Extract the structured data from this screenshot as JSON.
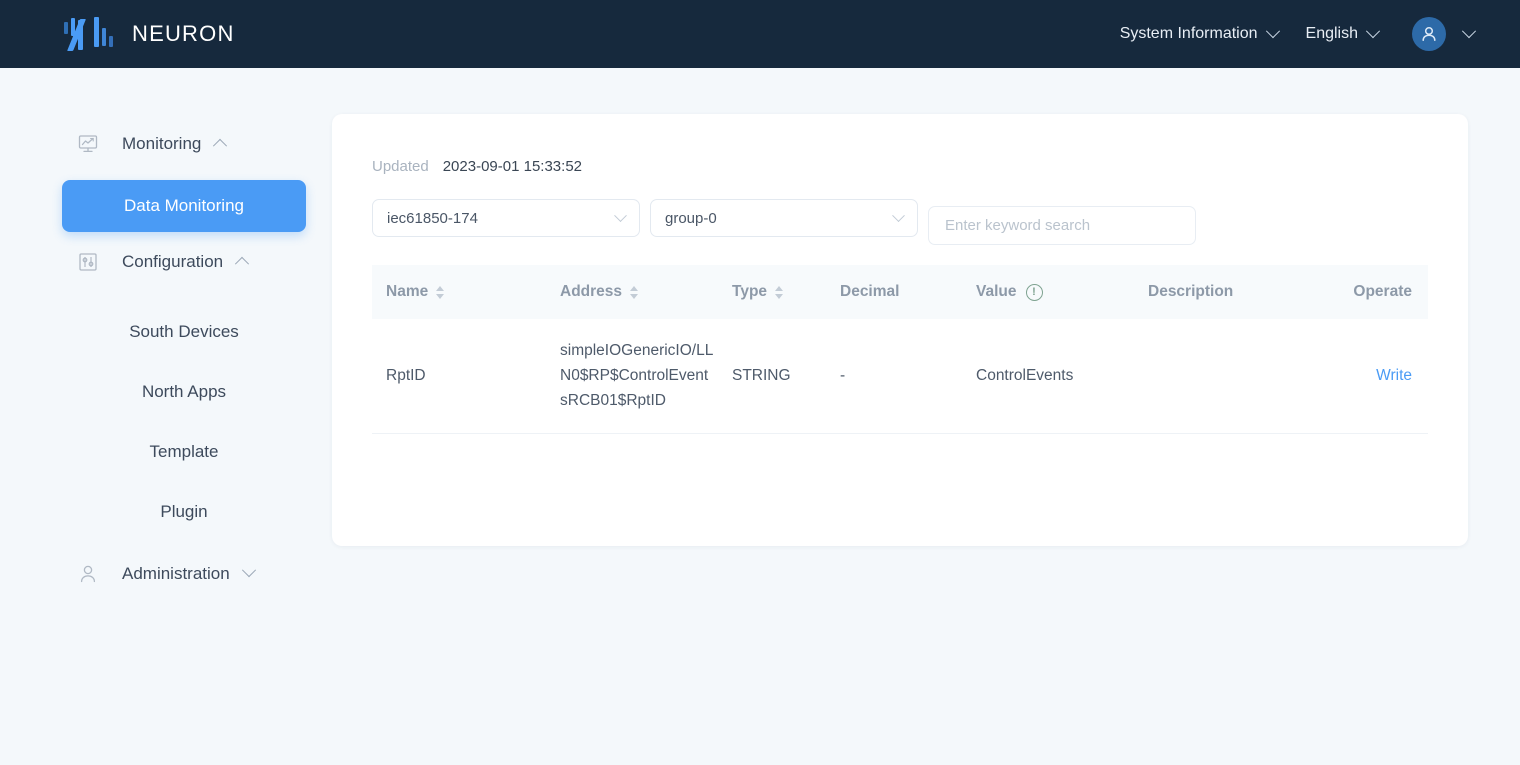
{
  "header": {
    "brand": "NEURON",
    "logo_icon": "neuron-logo-icon",
    "system_information": "System Information",
    "language": "English",
    "avatar_icon": "user-avatar-icon",
    "chevron_icon": "chevron-down-icon",
    "accent": "#4a9bf5",
    "background": "#16293d"
  },
  "sidebar": {
    "groups": [
      {
        "label": "Monitoring",
        "icon": "monitor-chart-icon",
        "expanded": true
      },
      {
        "label": "Configuration",
        "icon": "sliders-icon",
        "expanded": true
      },
      {
        "label": "Administration",
        "icon": "user-icon",
        "expanded": false
      }
    ],
    "monitoring_items": [
      {
        "label": "Data Monitoring",
        "active": true
      }
    ],
    "configuration_items": [
      {
        "label": "South Devices",
        "active": false
      },
      {
        "label": "North Apps",
        "active": false
      },
      {
        "label": "Template",
        "active": false
      },
      {
        "label": "Plugin",
        "active": false
      }
    ]
  },
  "main": {
    "updated_label": "Updated",
    "updated_value": "2023-09-01 15:33:52",
    "device_select": "iec61850-174",
    "group_select": "group-0",
    "search_placeholder": "Enter keyword search",
    "table": {
      "columns": [
        {
          "label": "Name",
          "sortable": true
        },
        {
          "label": "Address",
          "sortable": true
        },
        {
          "label": "Type",
          "sortable": true
        },
        {
          "label": "Decimal",
          "sortable": false
        },
        {
          "label": "Value",
          "sortable": false,
          "info_icon": "info-circle-icon"
        },
        {
          "label": "Description",
          "sortable": false
        },
        {
          "label": "Operate",
          "sortable": false
        }
      ],
      "rows": [
        {
          "name": "RptID",
          "address": "simpleIOGenericIO/LLN0$RP$ControlEventsRCB01$RptID",
          "type": "STRING",
          "decimal": "-",
          "value": "ControlEvents",
          "description": "",
          "operate": "Write"
        }
      ]
    }
  }
}
